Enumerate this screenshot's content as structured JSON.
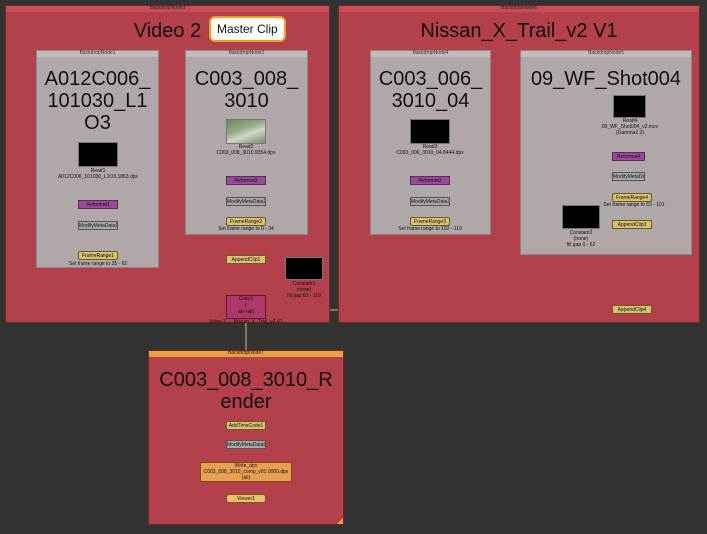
{
  "backdrops": {
    "left": {
      "name": "BackdropNode3",
      "title": "Video 2"
    },
    "right": {
      "name": "BackdropNode6",
      "title": "Nissan_X_Trail_v2 V1"
    },
    "bottom": {
      "name": "BackdropNode7",
      "title_line1": "C003_008_3010_R",
      "title_line2": "ender"
    }
  },
  "groups": {
    "g1": {
      "name": "BackdropNode1",
      "title_line1": "A012C006_",
      "title_line2": "101030_L1",
      "title_line3": "O3"
    },
    "g2": {
      "name": "BackdropNode2",
      "title_line1": "C003_008_",
      "title_line2": "3010"
    },
    "g4": {
      "name": "BackdropNode4",
      "title_line1": "C003_006_",
      "title_line2": "3010_04"
    },
    "g5": {
      "name": "BackdropNode5",
      "title_line1": "09_WF_Shot004"
    }
  },
  "tooltip": "Master Clip",
  "nodes": {
    "read1": {
      "line1": "Read1",
      "line2": "A012C006_101030_L1O3.1863.dpx"
    },
    "reformat1": "Reformat1",
    "modify1": "ModifyMetaData1",
    "framerange1": "FrameRange1",
    "framerange1_label": "Set frame range to 35 - 62",
    "read2": {
      "line1": "Read2",
      "line2": "C003_008_3010.9354.dpx"
    },
    "reformat2": "Reformat2",
    "modify2": "ModifyMetaData2",
    "framerange2": "FrameRange2",
    "framerange2_label": "Set frame range to 0 - 34",
    "appendclip1": "AppendClip1",
    "constant1": {
      "line1": "Constant1",
      "line2": "(none)",
      "line3": "fill gap 63 - 119"
    },
    "copy1": {
      "line1": "Copy1",
      "line2": "(",
      "line3": "all->all)"
    },
    "copy1_label": "Video 2 → Nissan_X_Trail_v2 V1",
    "read3": {
      "line1": "Read3",
      "line2": "C003_006_3010_04.8444.dpx"
    },
    "reformat3": "Reformat3",
    "modify3": "ModifyMetaData3",
    "framerange3": "FrameRange3",
    "framerange3_label": "Set frame range to 102 - 119",
    "read4": {
      "line1": "Read4",
      "line2": "09_WF_Shot004_v2.mov",
      "line3": "(Gamma2.2)"
    },
    "reformat4": "Reformat4",
    "modify4": "ModifyMetaData4",
    "framerange4": "FrameRange4",
    "framerange4_label": "Set frame range to 63 - 101",
    "appendclip3": "AppendClip3",
    "constant2": {
      "line1": "Constant2",
      "line2": "(none)",
      "line3": "fill gap 0 - 62"
    },
    "appendclip4": "AppendClip4",
    "addtimecode1": "AddTimeCode1",
    "modify5": "ModifyMetaData5",
    "write": {
      "line1": "Write_dpx",
      "line2": "C003_008_3010_comp_v01.0000.dpx",
      "line3": "(all)"
    },
    "viewer1": "Viewer1"
  }
}
